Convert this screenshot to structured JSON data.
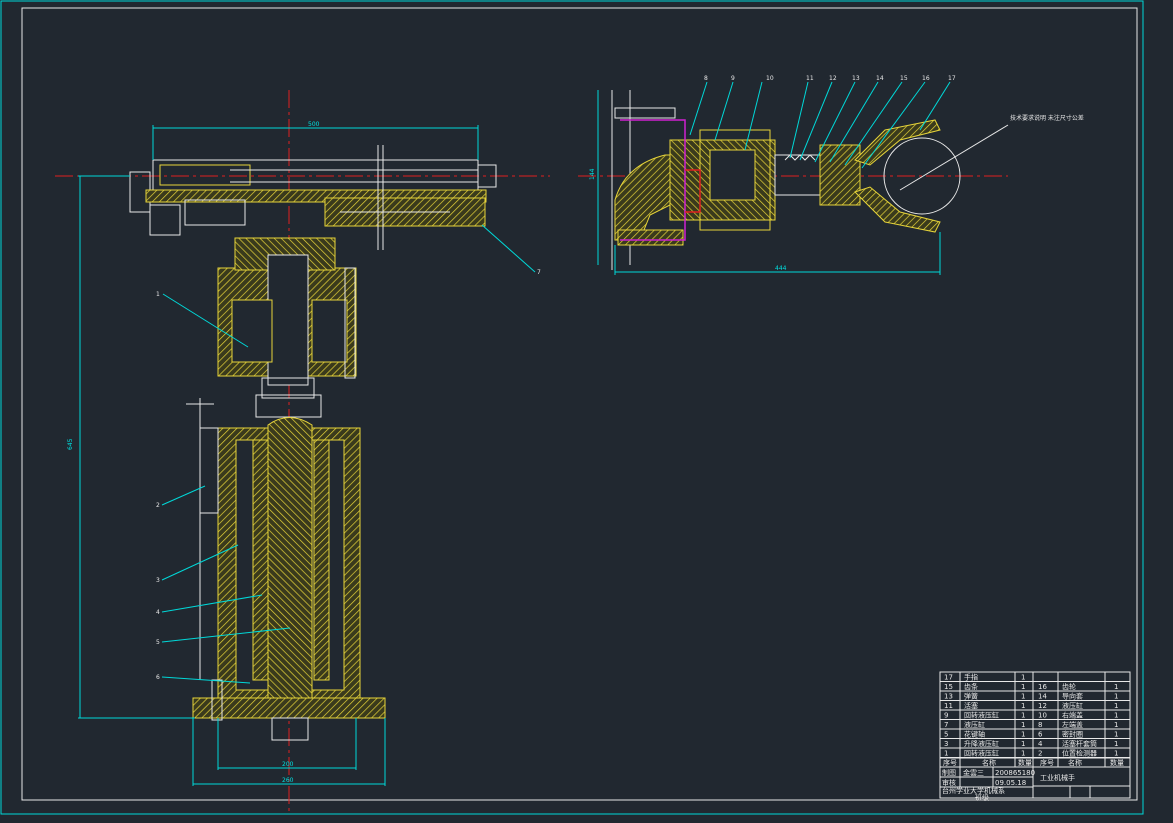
{
  "drawing": {
    "title": "工业机械手",
    "side_dims": {
      "left_height": "645",
      "horizontal_top": "500",
      "base_inner": "200",
      "base_outer": "260"
    },
    "gripper_dims": {
      "height": "144",
      "length": "444"
    },
    "callouts_side": [
      "1",
      "2",
      "3",
      "4",
      "5",
      "6",
      "7"
    ],
    "callouts_gripper": [
      "8",
      "9",
      "10",
      "11",
      "12",
      "13",
      "14",
      "15",
      "16",
      "17"
    ],
    "note": "技术要求说明\n未注尺寸公差"
  },
  "title_block": {
    "header": {
      "seq": "序号",
      "name": "名称",
      "qty": "数量"
    },
    "left_rows": [
      {
        "seq": "17",
        "name": "手指",
        "qty": "1"
      },
      {
        "seq": "15",
        "name": "齿条",
        "qty": "1"
      },
      {
        "seq": "13",
        "name": "弹簧",
        "qty": "1"
      },
      {
        "seq": "11",
        "name": "活塞",
        "qty": "1"
      },
      {
        "seq": "9",
        "name": "回转液压缸",
        "qty": "1"
      },
      {
        "seq": "7",
        "name": "液压缸",
        "qty": "1"
      },
      {
        "seq": "5",
        "name": "花键轴",
        "qty": "1"
      },
      {
        "seq": "3",
        "name": "升降液压缸",
        "qty": "1"
      },
      {
        "seq": "1",
        "name": "回转液压缸",
        "qty": "1"
      }
    ],
    "right_rows": [
      {
        "seq": "",
        "name": "",
        "qty": ""
      },
      {
        "seq": "16",
        "name": "齿轮",
        "qty": "1"
      },
      {
        "seq": "14",
        "name": "导向套",
        "qty": "1"
      },
      {
        "seq": "12",
        "name": "液压缸",
        "qty": "1"
      },
      {
        "seq": "10",
        "name": "右端盖",
        "qty": "1"
      },
      {
        "seq": "8",
        "name": "左端盖",
        "qty": "1"
      },
      {
        "seq": "6",
        "name": "密封圈",
        "qty": "1"
      },
      {
        "seq": "4",
        "name": "活塞杆套筒",
        "qty": "1"
      },
      {
        "seq": "2",
        "name": "位置检测器",
        "qty": "1"
      }
    ],
    "design_label": "制图",
    "designer": "金雲三",
    "student_no": "200865180",
    "check_label": "审核",
    "date": "09.05.18",
    "school": "台州学业大学机械系",
    "class_label": "班级",
    "drawing_name": "工业机械手"
  },
  "colors": {
    "background": "#212830",
    "frame": "#00d8d8",
    "part": "#e6d43a",
    "centerline": "#e02020",
    "dimension": "#00d8d8",
    "leader": "#00d8d8",
    "magenta": "#d020d0",
    "white": "#e8e8e8"
  }
}
